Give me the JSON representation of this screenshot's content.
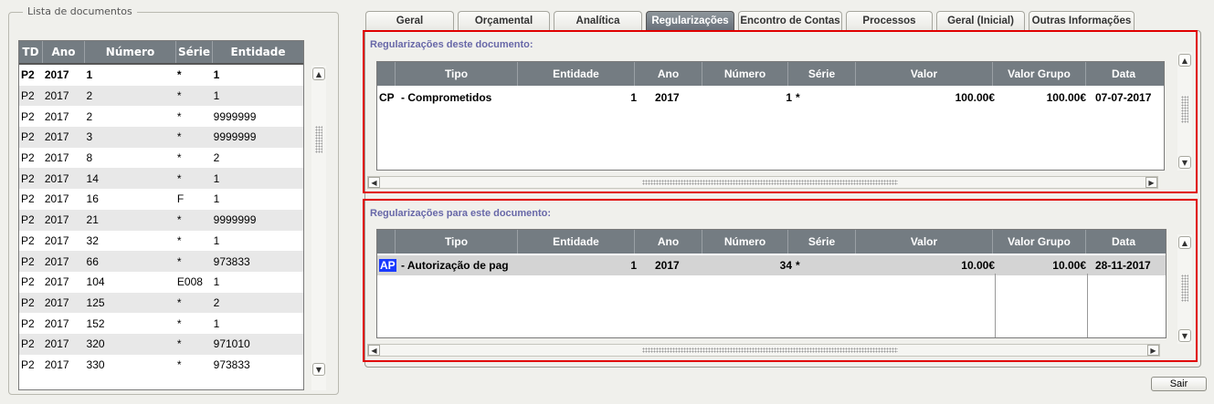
{
  "left_panel": {
    "legend": "Lista de documentos",
    "columns": [
      "TD",
      "Ano",
      "Número",
      "Série",
      "Entidade"
    ],
    "rows": [
      [
        "P2",
        "2017",
        "1",
        "*",
        "1"
      ],
      [
        "P2",
        "2017",
        "2",
        "*",
        "1"
      ],
      [
        "P2",
        "2017",
        "2",
        "*",
        "9999999"
      ],
      [
        "P2",
        "2017",
        "3",
        "*",
        "9999999"
      ],
      [
        "P2",
        "2017",
        "8",
        "*",
        "2"
      ],
      [
        "P2",
        "2017",
        "14",
        "*",
        "1"
      ],
      [
        "P2",
        "2017",
        "16",
        "F",
        "1"
      ],
      [
        "P2",
        "2017",
        "21",
        "*",
        "9999999"
      ],
      [
        "P2",
        "2017",
        "32",
        "*",
        "1"
      ],
      [
        "P2",
        "2017",
        "66",
        "*",
        "973833"
      ],
      [
        "P2",
        "2017",
        "104",
        "E008",
        "1"
      ],
      [
        "P2",
        "2017",
        "125",
        "*",
        "2"
      ],
      [
        "P2",
        "2017",
        "152",
        "*",
        "1"
      ],
      [
        "P2",
        "2017",
        "320",
        "*",
        "971010"
      ],
      [
        "P2",
        "2017",
        "330",
        "*",
        "973833"
      ]
    ]
  },
  "tabs": [
    {
      "label": "Geral",
      "active": false
    },
    {
      "label": "Orçamental",
      "active": false
    },
    {
      "label": "Analítica",
      "active": false
    },
    {
      "label": "Regularizações",
      "active": true
    },
    {
      "label": "Encontro de Contas",
      "active": false
    },
    {
      "label": "Processos",
      "active": false
    },
    {
      "label": "Geral (Inicial)",
      "active": false
    },
    {
      "label": "Outras Informações",
      "active": false
    }
  ],
  "reg_deste": {
    "title": "Regularizações deste documento:",
    "columns": [
      "Tipo",
      "Entidade",
      "Ano",
      "Número",
      "Série",
      "Valor",
      "Valor Grupo",
      "Data"
    ],
    "rows": [
      {
        "code": "CP",
        "tipo": " - Comprometidos",
        "entidade": "1",
        "ano": "2017",
        "numero": "1",
        "serie": "*",
        "valor": "100.00€",
        "valor_grupo": "100.00€",
        "data": "07-07-2017"
      }
    ]
  },
  "reg_para": {
    "title": "Regularizações para este documento:",
    "columns": [
      "Tipo",
      "Entidade",
      "Ano",
      "Número",
      "Série",
      "Valor",
      "Valor Grupo",
      "Data"
    ],
    "rows": [
      {
        "code": "AP",
        "tipo": " - Autorização de pag",
        "entidade": "1",
        "ano": "2017",
        "numero": "34",
        "serie": "*",
        "valor": "10.00€",
        "valor_grupo": "10.00€",
        "data": "28-11-2017"
      }
    ]
  },
  "buttons": {
    "sair": "Sair"
  },
  "icons": {
    "scroll_up": "triangle-up-icon",
    "scroll_down": "triangle-down-icon",
    "scroll_left": "triangle-left-icon",
    "scroll_right": "triangle-right-icon"
  },
  "colors": {
    "header_bg": "#747c82",
    "active_tab": "#68707a",
    "highlight_border": "#e00000",
    "section_title": "#6868a8",
    "selection": "#1a3aff"
  }
}
